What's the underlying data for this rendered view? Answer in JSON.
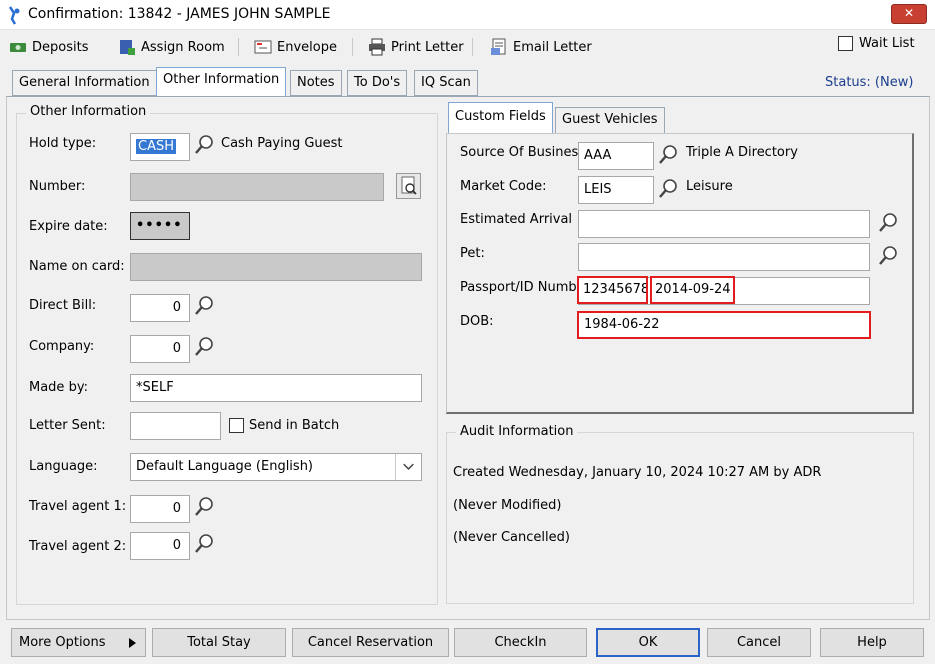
{
  "window": {
    "title": "Confirmation: 13842 - JAMES JOHN SAMPLE"
  },
  "toolbar": {
    "deposits": "Deposits",
    "assign_room": "Assign Room",
    "envelope": "Envelope",
    "print_letter": "Print Letter",
    "email_letter": "Email Letter",
    "wait_list": "Wait List"
  },
  "tabs": [
    "General Information",
    "Other Information",
    "Notes",
    "To Do's",
    "IQ Scan"
  ],
  "status": "Status: (New)",
  "other_info": {
    "legend": "Other Information",
    "hold_type_label": "Hold type:",
    "hold_type_value": "CASH",
    "hold_type_desc": "Cash Paying Guest",
    "number_label": "Number:",
    "expire_label": "Expire date:",
    "expire_value": "•••••",
    "name_on_card_label": "Name on card:",
    "direct_bill_label": "Direct Bill:",
    "direct_bill_value": "0",
    "company_label": "Company:",
    "company_value": "0",
    "made_by_label": "Made by:",
    "made_by_value": "*SELF",
    "letter_sent_label": "Letter Sent:",
    "send_in_batch": "Send in Batch",
    "language_label": "Language:",
    "language_value": "Default Language (English)",
    "travel_agent1_label": "Travel agent 1:",
    "travel_agent1_value": "0",
    "travel_agent2_label": "Travel agent 2:",
    "travel_agent2_value": "0"
  },
  "subtabs": [
    "Custom Fields",
    "Guest Vehicles"
  ],
  "custom_fields": {
    "source_label": "Source Of Busines",
    "source_value": "AAA",
    "source_desc": "Triple A Directory",
    "market_label": "Market Code:",
    "market_value": "LEIS",
    "market_desc": "Leisure",
    "arrival_label": "Estimated Arrival",
    "pet_label": "Pet:",
    "passport_label": "Passport/ID Numbe",
    "passport_value": "12345678",
    "passport_date": "2014-09-24",
    "dob_label": "DOB:",
    "dob_value": "1984-06-22"
  },
  "audit": {
    "legend": "Audit Information",
    "created": "Created Wednesday,  January 10, 2024 10:27 AM by ADR",
    "modified": "(Never Modified)",
    "cancelled": "(Never Cancelled)"
  },
  "buttons": {
    "more_options": "More Options",
    "total_stay": "Total Stay",
    "cancel_reservation": "Cancel Reservation",
    "checkin": "CheckIn",
    "ok": "OK",
    "cancel": "Cancel",
    "help": "Help"
  }
}
